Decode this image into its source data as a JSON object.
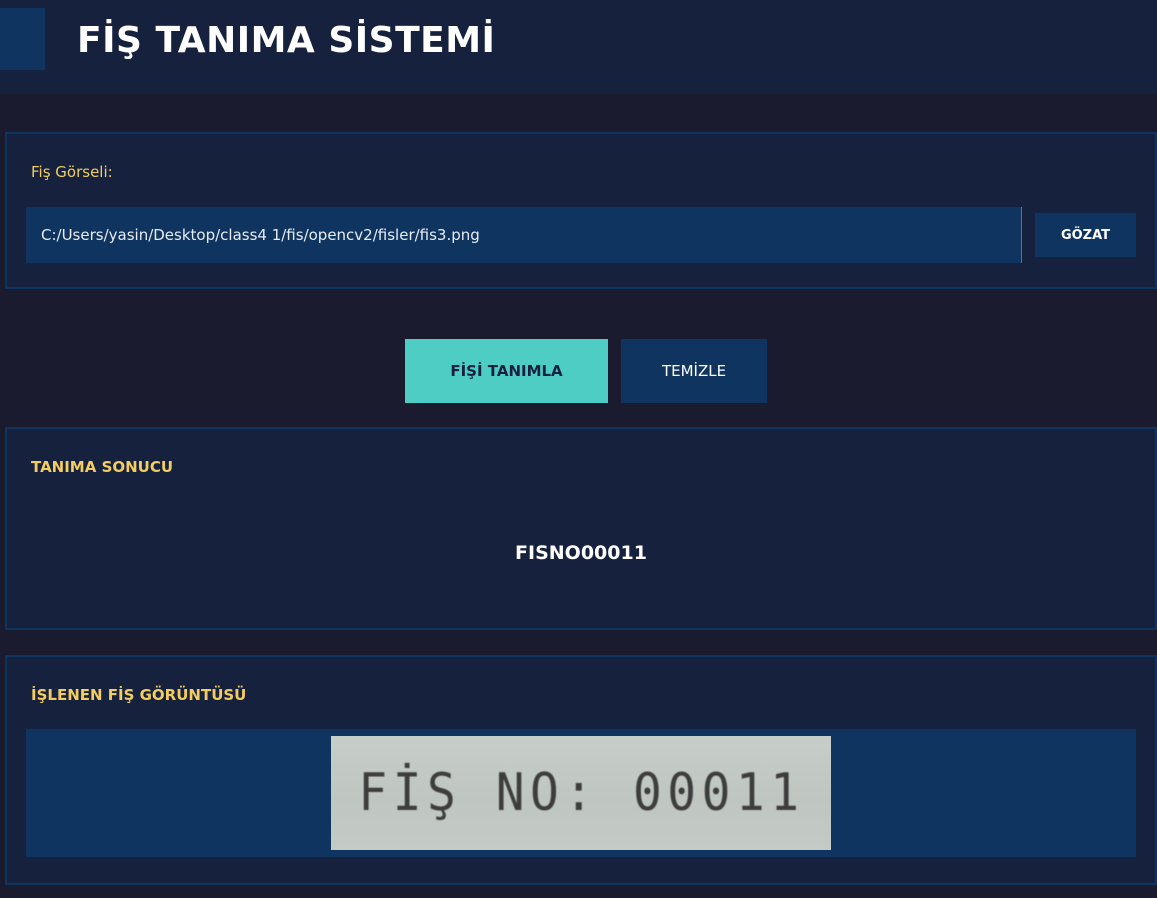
{
  "header": {
    "title": "FİŞ TANIMA SİSTEMİ"
  },
  "file_panel": {
    "label": "Fiş Görseli:",
    "path_value": "C:/Users/yasin/Desktop/class4 1/fis/opencv2/fisler/fis3.png",
    "browse_label": "GÖZAT"
  },
  "actions": {
    "recognize_label": "FİŞİ TANIMLA",
    "clear_label": "TEMİZLE"
  },
  "result_panel": {
    "heading": "TANIMA SONUCU",
    "value": "FISNO00011"
  },
  "image_panel": {
    "heading": "İŞLENEN FİŞ GÖRÜNTÜSÜ",
    "image_text": "FİŞ NO: 00011"
  },
  "colors": {
    "background": "#1a1b2e",
    "panel": "#16213e",
    "accent_blue": "#0f3460",
    "accent_teal": "#4ecdc4",
    "label_yellow": "#f3cd62"
  }
}
